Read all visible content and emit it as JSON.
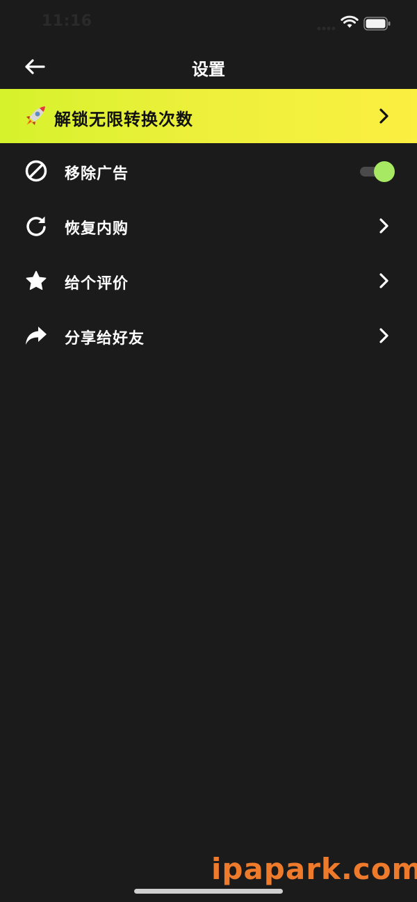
{
  "status_bar": {
    "time": "11:16",
    "signal_icon": "signal-bars-icon",
    "wifi_icon": "wifi-icon",
    "battery_icon": "battery-icon"
  },
  "nav": {
    "title": "设置",
    "back_icon": "arrow-left-icon"
  },
  "promo": {
    "icon": "rocket-icon",
    "label": "解锁无限转换次数",
    "colors": {
      "gradient_start": "#d5f22c",
      "gradient_end": "#fbef41"
    }
  },
  "settings": {
    "items": [
      {
        "label": "移除广告",
        "icon": "block-icon",
        "control": "toggle",
        "toggle_on": true
      },
      {
        "label": "恢复内购",
        "icon": "refresh-icon",
        "control": "chevron"
      },
      {
        "label": "给个评价",
        "icon": "star-icon",
        "control": "chevron"
      },
      {
        "label": "分享给好友",
        "icon": "share-icon",
        "control": "chevron"
      }
    ]
  },
  "colors": {
    "background": "#1b1b1b",
    "toggle_on": "#a7e963",
    "watermark": "#ee7a2b"
  },
  "watermark": "ipapark.com"
}
